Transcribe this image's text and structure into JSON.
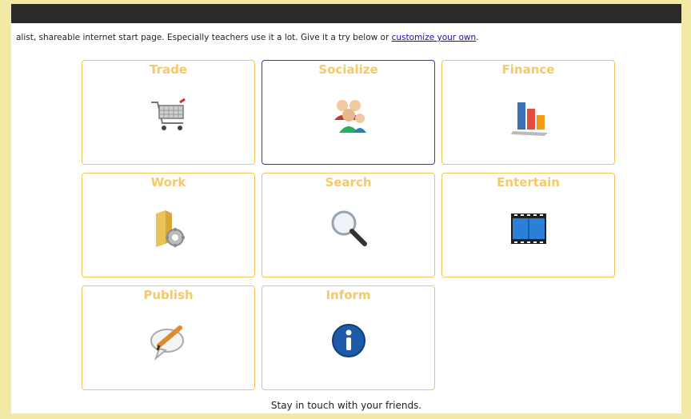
{
  "intro": {
    "text": "alist, shareable internet start page. Especially teachers use it a lot. Give it a try below or ",
    "link": "customize your own",
    "suffix": "."
  },
  "tiles": [
    {
      "label": "Trade",
      "icon": "shopping-cart-icon"
    },
    {
      "label": "Socialize",
      "icon": "people-icon"
    },
    {
      "label": "Finance",
      "icon": "bar-chart-icon"
    },
    {
      "label": "Work",
      "icon": "folder-gear-icon"
    },
    {
      "label": "Search",
      "icon": "magnifier-icon"
    },
    {
      "label": "Entertain",
      "icon": "film-strip-icon"
    },
    {
      "label": "Publish",
      "icon": "speech-bubble-pencil-icon"
    },
    {
      "label": "Inform",
      "icon": "info-icon"
    }
  ],
  "caption": "Stay in touch with your friends.",
  "colors": {
    "tile_title": "#f5c96a",
    "tile_border": "#f0c55a",
    "active_border": "#3535c0",
    "top_bar": "#2a2a2a",
    "frame": "#f3e9a6"
  }
}
